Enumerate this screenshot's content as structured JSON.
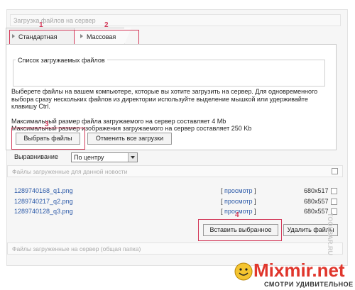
{
  "window": {
    "title": "Загрузка файлов на сервер"
  },
  "tabs": [
    {
      "label": "Стандартная",
      "marker": "1"
    },
    {
      "label": "Массовая",
      "marker": "2"
    }
  ],
  "upload": {
    "legend": "Список загружаемых файлов",
    "instructions": [
      "Выберете файлы на вашем компьютере, которые вы хотите загрузить на сервер. Для одновременного",
      "выбора сразу нескольких файлов из директории используйте выделение мышкой или удерживайте",
      "клавишу Ctrl."
    ],
    "limit_file": "Максимальный размер файла загружаемого на сервер составляет 4 Mb",
    "limit_image": "Максимальный размер изображения загружаемого на сервер составляет 250 Kb",
    "choose_button": "Выбрать файлы",
    "choose_marker": "3",
    "cancel_button": "Отменить все загрузки"
  },
  "alignment": {
    "label": "Выравнивание",
    "value": "По центру"
  },
  "section_news": {
    "title": "Файлы загруженные для данной новости"
  },
  "files": [
    {
      "name": "1289740168_q1.png",
      "view": "просмотр",
      "size": "680x517"
    },
    {
      "name": "1289740217_q2.png",
      "view": "просмотр",
      "size": "680x557"
    },
    {
      "name": "1289740128_q3.png",
      "view": "просмотр",
      "size": "680x557"
    }
  ],
  "bracket_open": "[",
  "bracket_close": "]",
  "actions": {
    "insert_button": "Вставить выбранное",
    "insert_marker": "4",
    "delete_button": "Удалить файлы"
  },
  "section_server": {
    "title": "Файлы загруженные на сервер (общая папка)"
  },
  "watermark": {
    "brand": "Mixmir.net",
    "tagline": "СМОТРИ УДИВИТЕЛЬНОЕ",
    "side": "TOOLBAR.RU",
    "accent_color": "#e0362c"
  }
}
